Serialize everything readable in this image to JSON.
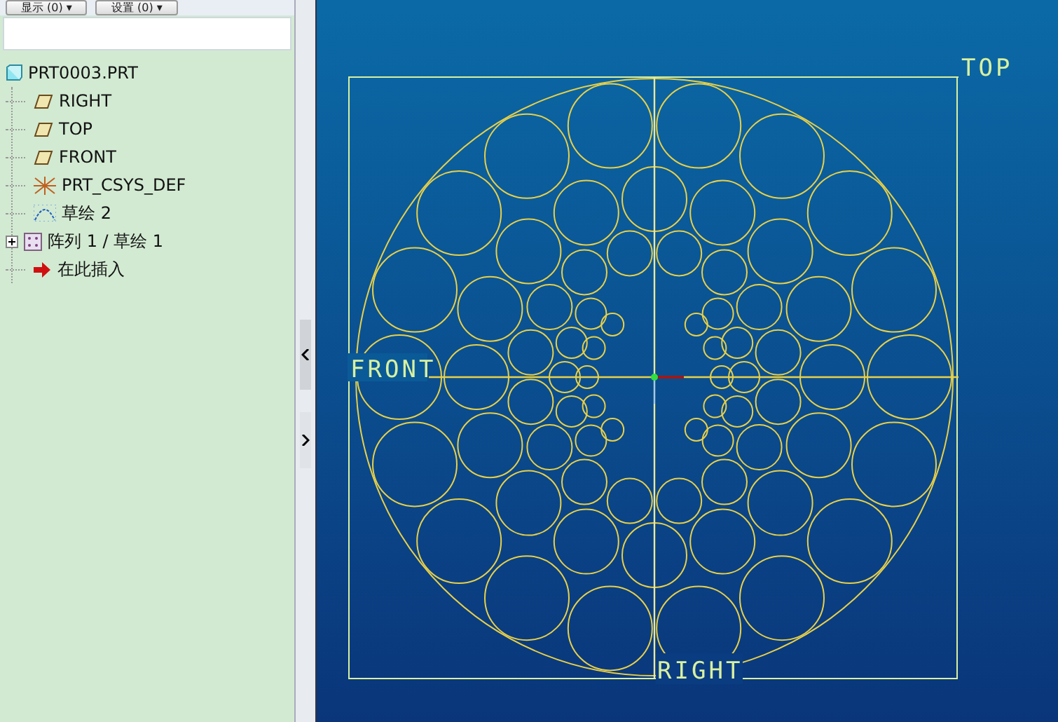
{
  "toolbar": {
    "buttons": [
      {
        "label": "显示 (0) ▾"
      },
      {
        "label": "设置 (0) ▾"
      }
    ]
  },
  "model_tree": {
    "items": [
      {
        "kind": "part",
        "label": "PRT0003.PRT",
        "children": [
          {
            "kind": "plane",
            "label": "RIGHT"
          },
          {
            "kind": "plane",
            "label": "TOP"
          },
          {
            "kind": "plane",
            "label": "FRONT"
          },
          {
            "kind": "csys",
            "label": "PRT_CSYS_DEF"
          },
          {
            "kind": "sketch",
            "label": "草绘 2"
          },
          {
            "kind": "pattern",
            "label": "阵列 1 / 草绘 1",
            "expanded": false
          },
          {
            "kind": "insert",
            "label": "在此插入"
          }
        ]
      }
    ]
  },
  "viewport": {
    "datum_labels": [
      {
        "kind": "top",
        "label": "TOP"
      },
      {
        "kind": "front",
        "label": "FRONT"
      },
      {
        "kind": "right",
        "label": "RIGHT"
      }
    ]
  }
}
